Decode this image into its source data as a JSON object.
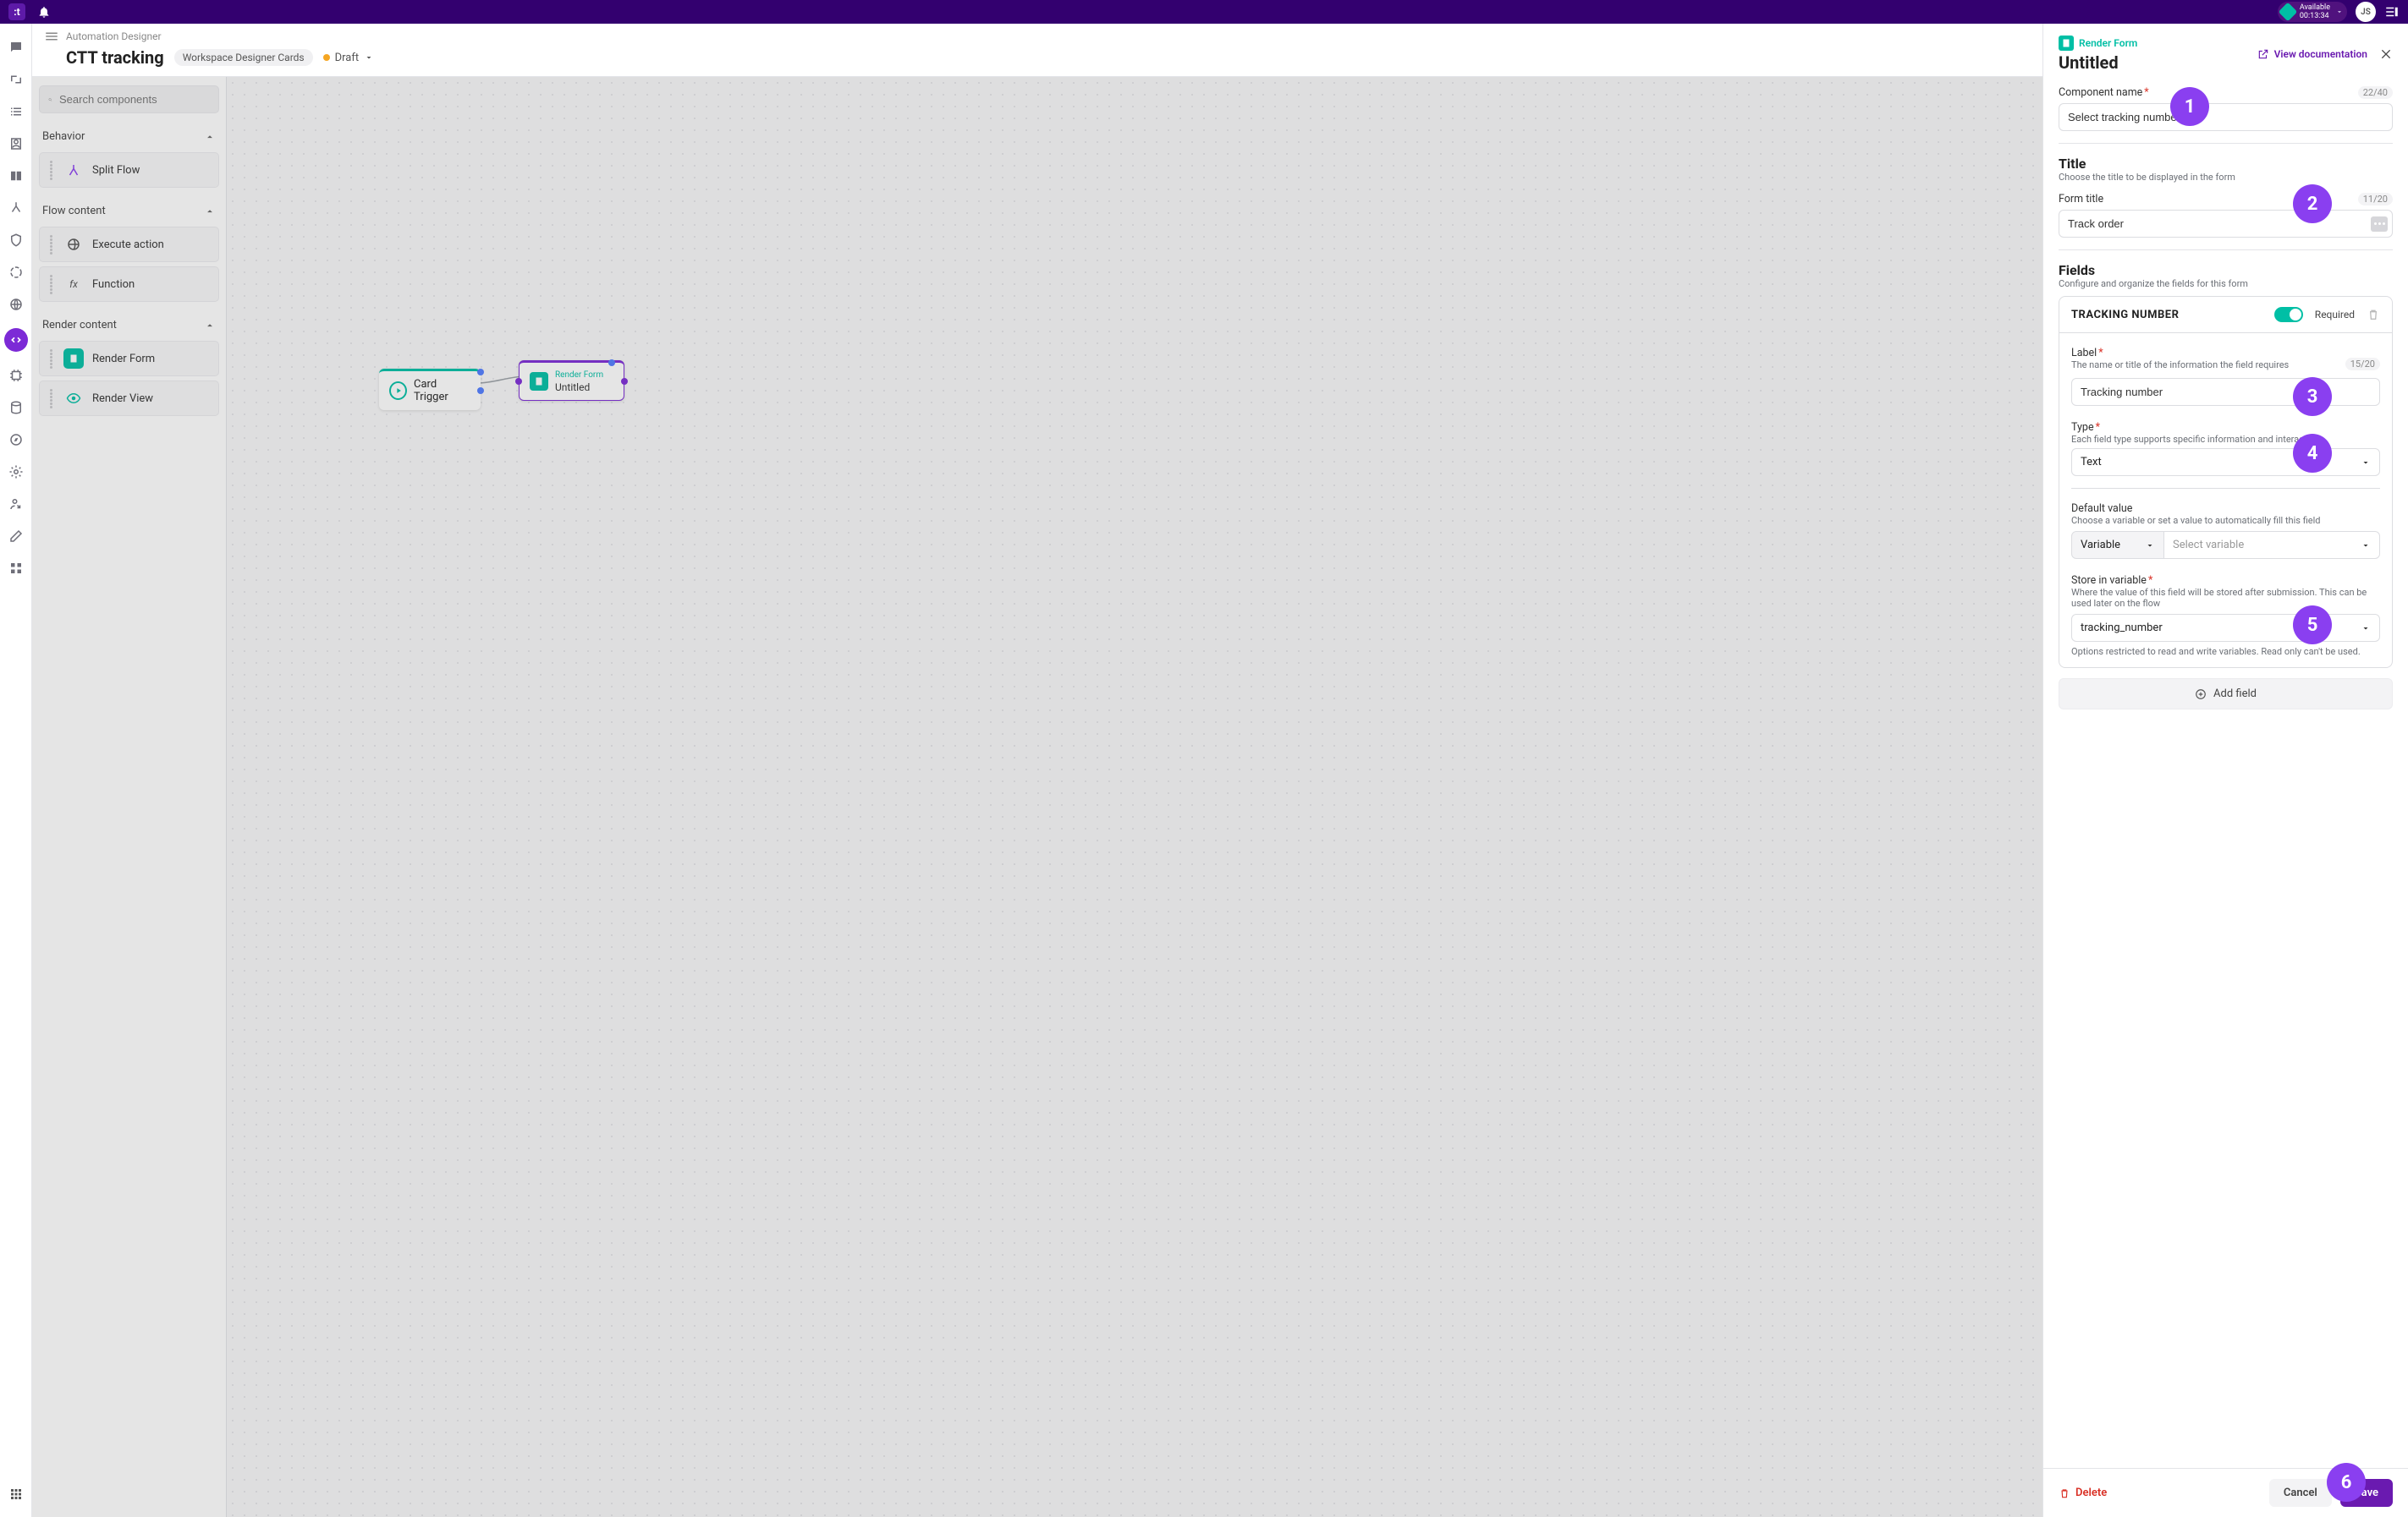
{
  "topbar": {
    "logo_text": ":t",
    "status_label": "Available",
    "status_timer": "00:13:34",
    "avatar_initials": "JS"
  },
  "rail_icons": [
    "chat-icon",
    "link-icon",
    "list-icon",
    "contact-icon",
    "columns-icon",
    "branch-icon",
    "shield-icon",
    "segment-icon",
    "globe-icon",
    "code-icon",
    "chip-icon",
    "storage-icon",
    "compass-icon",
    "gear-icon",
    "person-arrow-icon",
    "edit-icon",
    "apps-icon"
  ],
  "workspace": {
    "breadcrumb": "Automation Designer",
    "title": "CTT tracking",
    "chip": "Workspace Designer Cards",
    "status": "Draft",
    "search_placeholder": "Search components",
    "groups": [
      {
        "name": "Behavior",
        "items": [
          {
            "label": "Split Flow",
            "icon": "split"
          }
        ]
      },
      {
        "name": "Flow content",
        "items": [
          {
            "label": "Execute action",
            "icon": "globe"
          },
          {
            "label": "Function",
            "icon": "fx"
          }
        ]
      },
      {
        "name": "Render content",
        "items": [
          {
            "label": "Render Form",
            "icon": "form"
          },
          {
            "label": "Render View",
            "icon": "eye"
          }
        ]
      }
    ],
    "canvas": {
      "trigger_label": "Card Trigger",
      "render_type": "Render Form",
      "render_label": "Untitled"
    }
  },
  "panel": {
    "type": "Render Form",
    "title": "Untitled",
    "view_doc": "View documentation",
    "comp_name_label": "Component name",
    "comp_name_counter": "22/40",
    "comp_name_value": "Select tracking number",
    "title_heading": "Title",
    "title_sub": "Choose the title to be displayed in the form",
    "form_title_label": "Form title",
    "form_title_counter": "11/20",
    "form_title_value": "Track order",
    "fields_heading": "Fields",
    "fields_sub": "Configure and organize the fields for this form",
    "field": {
      "name": "TRACKING NUMBER",
      "required": "Required",
      "label_heading": "Label",
      "label_sub": "The name or title of the information the field requires",
      "label_counter": "15/20",
      "label_value": "Tracking number",
      "type_heading": "Type",
      "type_sub": "Each field type supports specific information and interactions",
      "type_value": "Text",
      "default_heading": "Default value",
      "default_sub": "Choose a variable or set a value to automatically fill this field",
      "default_mode": "Variable",
      "default_placeholder": "Select variable",
      "store_heading": "Store in variable",
      "store_sub": "Where the value of this field will be stored after submission. This can be used later on the flow",
      "store_value": "tracking_number",
      "store_hint": "Options restricted to read and write variables. Read only can't be used."
    },
    "add_field": "Add field",
    "delete": "Delete",
    "cancel": "Cancel",
    "save": "Save"
  },
  "callouts": {
    "c1": "1",
    "c2": "2",
    "c3": "3",
    "c4": "4",
    "c5": "5",
    "c6": "6"
  }
}
